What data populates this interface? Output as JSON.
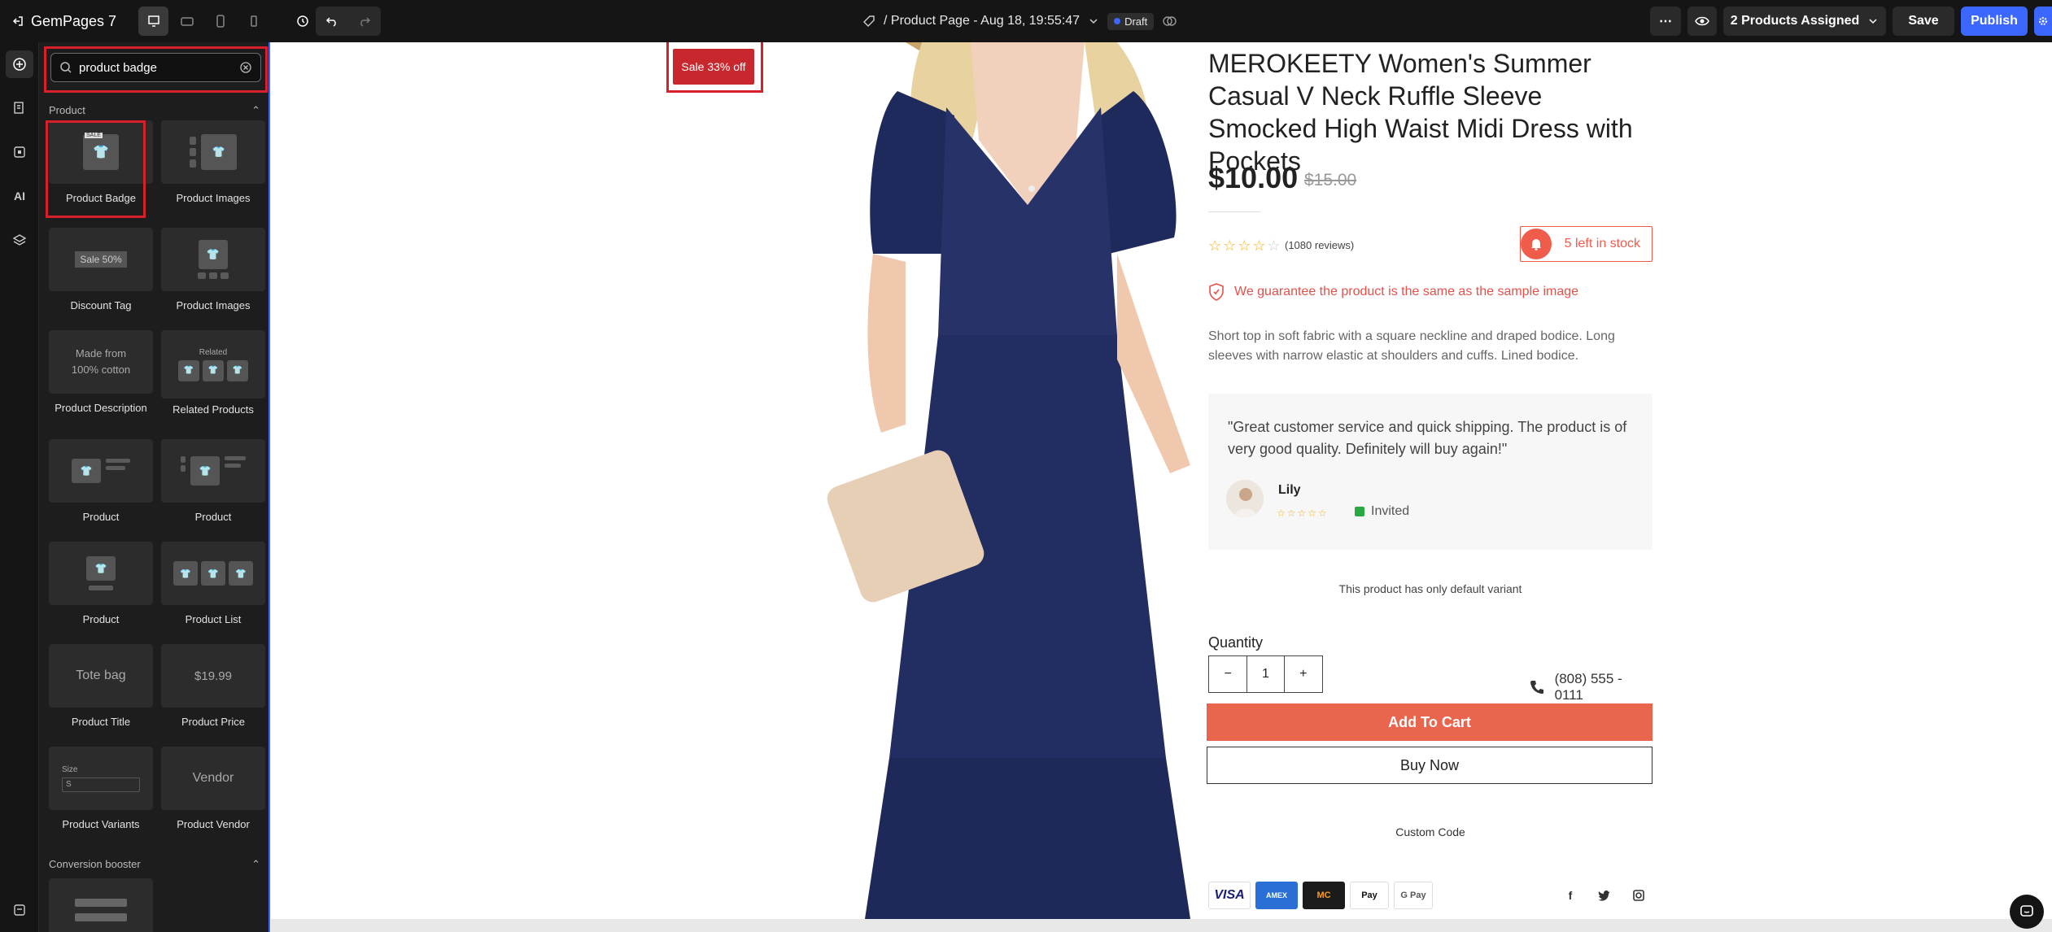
{
  "topbar": {
    "app_name": "GemPages 7",
    "page_title": "/ Product Page - Aug 18, 19:55:47",
    "draft_label": "Draft",
    "assigned_label": "2 Products Assigned",
    "save_label": "Save",
    "publish_label": "Publish"
  },
  "panel": {
    "search_value": "product badge",
    "section_product": "Product",
    "section_conversion": "Conversion booster",
    "tiles": [
      {
        "label": "Product Badge"
      },
      {
        "label": "Product Images"
      },
      {
        "label": "Discount Tag",
        "thumb": "Sale 50%"
      },
      {
        "label": "Product Images"
      },
      {
        "label": "Product Description",
        "thumb": "Made from 100% cotton"
      },
      {
        "label": "Related Products",
        "thumb": "Related"
      },
      {
        "label": "Product"
      },
      {
        "label": "Product"
      },
      {
        "label": "Product"
      },
      {
        "label": "Product List"
      },
      {
        "label": "Product Title",
        "thumb": "Tote bag"
      },
      {
        "label": "Product Price",
        "thumb": "$19.99"
      },
      {
        "label": "Product Variants",
        "thumb": "Size",
        "thumb_value": "S"
      },
      {
        "label": "Product Vendor",
        "thumb": "Vendor"
      }
    ]
  },
  "product": {
    "badge": "Sale 33% off",
    "title": "MEROKEETY Women's Summer Casual V Neck Ruffle Sleeve Smocked High Waist Midi Dress with Pockets",
    "price": "$10.00",
    "compare_price": "$15.00",
    "reviews": "(1080 reviews)",
    "rating": 0,
    "stock": "5 left in stock",
    "guarantee": "We guarantee the product is the same as the sample image",
    "description": "Short top in soft fabric with a square neckline and draped bodice. Long sleeves with narrow elastic at shoulders and cuffs. Lined bodice.",
    "testimonial": {
      "quote": "\"Great customer service and quick shipping. The product is of very good quality. Definitely will buy again!\"",
      "name": "Lily",
      "tag": "Invited"
    },
    "variant_note": "This product has only default variant",
    "quantity_label": "Quantity",
    "quantity": "1",
    "phone": "(808) 555 - 0111",
    "add_to_cart": "Add To Cart",
    "buy_now": "Buy Now",
    "custom_code": "Custom Code",
    "payments": [
      "VISA",
      "AMEX",
      "MC",
      "Pay",
      "G Pay"
    ],
    "social": [
      "f",
      "t",
      "ig"
    ]
  },
  "colors": {
    "accent": "#3c67ff",
    "highlight": "#d8202a",
    "cart": "#e9654e",
    "sale": "#c8272d"
  }
}
